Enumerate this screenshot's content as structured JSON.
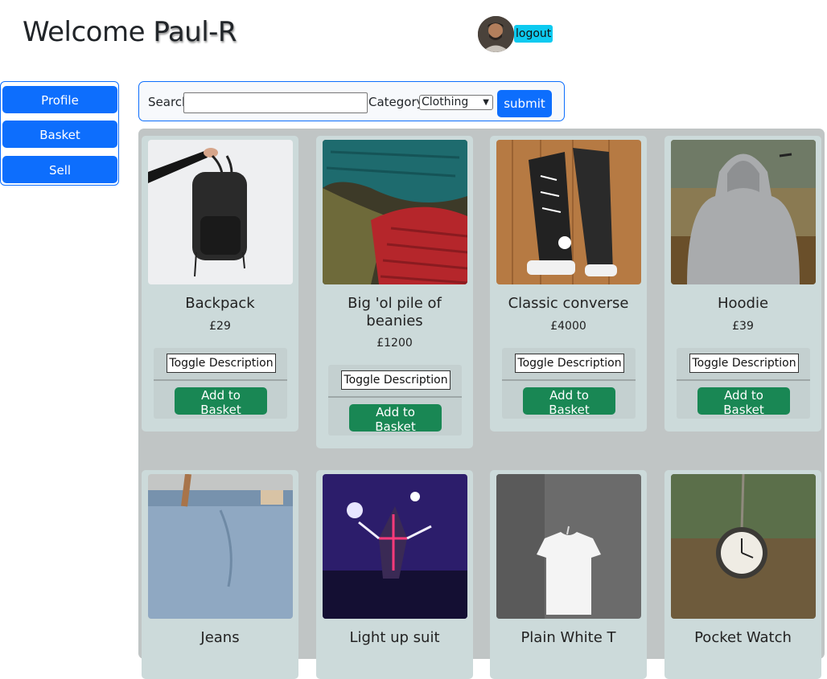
{
  "header": {
    "welcome": "Welcome",
    "username": "Paul-R",
    "logout_label": "logout"
  },
  "sidebar": {
    "items": [
      {
        "label": "Profile"
      },
      {
        "label": "Basket"
      },
      {
        "label": "Sell"
      }
    ]
  },
  "search": {
    "label": "Search",
    "value": "",
    "category_label": "Category:",
    "category_selected": "Clothing",
    "submit_label": "submit"
  },
  "colors": {
    "primary": "#0d6efd",
    "success": "#198754",
    "info": "#0dcaf0"
  },
  "products": [
    {
      "name": "Backpack",
      "price": "£29",
      "image": "backpack-photo"
    },
    {
      "name": "Big 'ol pile of beanies",
      "price": "£1200",
      "image": "beanies-photo"
    },
    {
      "name": "Classic converse",
      "price": "£4000",
      "image": "converse-photo"
    },
    {
      "name": "Hoodie",
      "price": "£39",
      "image": "hoodie-photo"
    },
    {
      "name": "Jeans",
      "price": "",
      "image": "jeans-photo"
    },
    {
      "name": "Light up suit",
      "price": "",
      "image": "light-suit-photo"
    },
    {
      "name": "Plain White T",
      "price": "",
      "image": "white-tshirt-photo"
    },
    {
      "name": "Pocket Watch",
      "price": "",
      "image": "pocket-watch-photo"
    }
  ],
  "card_actions": {
    "toggle_label": "Toggle Description",
    "add_label": "Add to Basket"
  }
}
